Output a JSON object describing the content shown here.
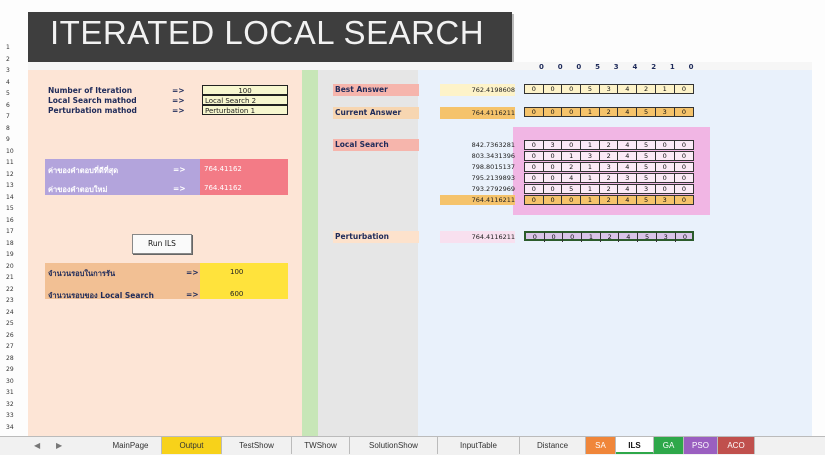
{
  "title": "ITERATED LOCAL SEARCH",
  "row_numbers": [
    "1",
    "2",
    "3",
    "4",
    "5",
    "6",
    "7",
    "8",
    "9",
    "10",
    "11",
    "12",
    "13",
    "14",
    "15",
    "16",
    "17",
    "18",
    "19",
    "20",
    "21",
    "22",
    "23",
    "24",
    "25",
    "26",
    "27",
    "28",
    "29",
    "30",
    "31",
    "32",
    "33",
    "34"
  ],
  "header_sequence": [
    "0",
    "0",
    "0",
    "5",
    "3",
    "4",
    "2",
    "1",
    "0"
  ],
  "params": {
    "iter_label": "Number of Iteration",
    "ls_label": "Local Search mathod",
    "pert_label": "Perturbation mathod",
    "arrow": "=>",
    "iter_value": "100",
    "ls_value": "Local Search 2",
    "pert_value": "Perturbation 1"
  },
  "bands": {
    "best_known_label": "ค่าของคำตอบที่ดีที่สุด",
    "best_known_value": "764.41162",
    "new_label": "ค่าของคำตอบใหม่",
    "new_value": "764.41162",
    "arrow": "=>"
  },
  "run_button": "Run ILS",
  "counts": {
    "rounds_label": "จำนวนรอบในการรัน",
    "rounds_value": "100",
    "ls_rounds_label": "จำนวนรอบของ Local Search",
    "ls_rounds_value": "600",
    "arrow": "=>"
  },
  "best": {
    "label": "Best Answer",
    "value": "762.4198608",
    "sequence": [
      "0",
      "0",
      "0",
      "5",
      "3",
      "4",
      "2",
      "1",
      "0"
    ]
  },
  "current": {
    "label": "Current Answer",
    "value": "764.4116211",
    "sequence": [
      "0",
      "0",
      "0",
      "1",
      "2",
      "4",
      "5",
      "3",
      "0"
    ]
  },
  "local_search": {
    "label": "Local Search",
    "rows": [
      {
        "value": "842.7363281",
        "sequence": [
          "0",
          "3",
          "0",
          "1",
          "2",
          "4",
          "5",
          "0",
          "0"
        ]
      },
      {
        "value": "803.3431396",
        "sequence": [
          "0",
          "0",
          "1",
          "3",
          "2",
          "4",
          "5",
          "0",
          "0"
        ]
      },
      {
        "value": "798.8015137",
        "sequence": [
          "0",
          "0",
          "2",
          "1",
          "3",
          "4",
          "5",
          "0",
          "0"
        ]
      },
      {
        "value": "795.2139893",
        "sequence": [
          "0",
          "0",
          "4",
          "1",
          "2",
          "3",
          "5",
          "0",
          "0"
        ]
      },
      {
        "value": "793.2792969",
        "sequence": [
          "0",
          "0",
          "5",
          "1",
          "2",
          "4",
          "3",
          "0",
          "0"
        ]
      },
      {
        "value": "764.4116211",
        "sequence": [
          "0",
          "0",
          "0",
          "1",
          "2",
          "4",
          "5",
          "3",
          "0"
        ]
      }
    ]
  },
  "perturbation": {
    "label": "Perturbation",
    "value": "764.4116211",
    "sequence": [
      "0",
      "0",
      "0",
      "1",
      "2",
      "4",
      "5",
      "3",
      "0"
    ]
  },
  "tabs": [
    {
      "label": "MainPage",
      "color": ""
    },
    {
      "label": "Output",
      "color": "#f7d21a"
    },
    {
      "label": "TestShow",
      "color": ""
    },
    {
      "label": "TWShow",
      "color": ""
    },
    {
      "label": "SolutionShow",
      "color": ""
    },
    {
      "label": "InputTable",
      "color": ""
    },
    {
      "label": "Distance",
      "color": ""
    },
    {
      "label": "SA",
      "color": "#f0863a"
    },
    {
      "label": "ILS",
      "color": "#ffffff"
    },
    {
      "label": "GA",
      "color": "#2ea84a"
    },
    {
      "label": "PSO",
      "color": "#9a5fc0"
    },
    {
      "label": "ACO",
      "color": "#c0504d"
    }
  ],
  "colors": {
    "banner": "#3e3e3e",
    "left_panel": "#fde5d6",
    "right_panel": "#e9f1fb",
    "purple_band": "#b3a4dc",
    "red_box": "#f37b86",
    "orange_band": "#f2c094",
    "yellow_box": "#ffe33c",
    "local_search_frame": "#f1b6e4"
  }
}
